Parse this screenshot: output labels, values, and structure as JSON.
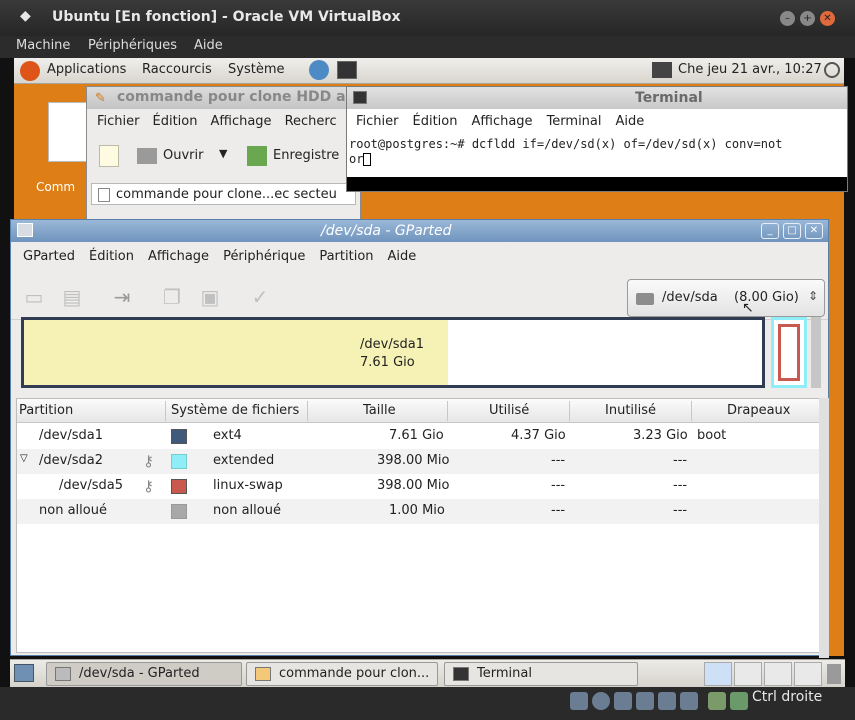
{
  "vbox": {
    "title": "Ubuntu [En fonction] - Oracle VM VirtualBox",
    "menu": [
      "Machine",
      "Périphériques",
      "Aide"
    ],
    "host_key": "Ctrl droite"
  },
  "panel": {
    "menus": [
      "Applications",
      "Raccourcis",
      "Système"
    ],
    "clock": "Che jeu 21 avr., 10:27"
  },
  "desktop": {
    "icon_label": "Comm"
  },
  "gedit": {
    "title": "commande pour clone HDD a",
    "menu": [
      "Fichier",
      "Édition",
      "Affichage",
      "Recherc"
    ],
    "open_label": "Ouvrir",
    "save_label": "Enregistre",
    "tab_label": "commande pour clone...ec secteu"
  },
  "terminal": {
    "title": "Terminal",
    "menu": [
      "Fichier",
      "Édition",
      "Affichage",
      "Terminal",
      "Aide"
    ],
    "line1": "root@postgres:~# dcfldd if=/dev/sd(x) of=/dev/sd(x) conv=not",
    "line2": "or"
  },
  "gparted": {
    "title": "/dev/sda - GParted",
    "menu": [
      "GParted",
      "Édition",
      "Affichage",
      "Périphérique",
      "Partition",
      "Aide"
    ],
    "device": "/dev/sda",
    "device_size": "(8.00 Gio)",
    "graph_label_name": "/dev/sda1",
    "graph_label_size": "7.61 Gio",
    "graph_used_fraction": 0.57,
    "columns": [
      "Partition",
      "Système de fichiers",
      "Taille",
      "Utilisé",
      "Inutilisé",
      "Drapeaux"
    ],
    "rows": [
      {
        "partition": "/dev/sda1",
        "fs": "ext4",
        "size": "7.61 Gio",
        "used": "4.37 Gio",
        "unused": "3.23 Gio",
        "flags": "boot",
        "color": "#3f5a7a"
      },
      {
        "partition": "/dev/sda2",
        "fs": "extended",
        "size": "398.00 Mio",
        "used": "---",
        "unused": "---",
        "flags": "",
        "color": "#8eedf6"
      },
      {
        "partition": "/dev/sda5",
        "fs": "linux-swap",
        "size": "398.00 Mio",
        "used": "---",
        "unused": "---",
        "flags": "",
        "color": "#c9594e"
      },
      {
        "partition": "non alloué",
        "fs": "non alloué",
        "size": "1.00 Mio",
        "used": "---",
        "unused": "---",
        "flags": "",
        "color": "#a8a8a8"
      }
    ]
  },
  "taskbar": {
    "tasks": [
      "/dev/sda - GParted",
      "commande pour clon...",
      "Terminal"
    ]
  }
}
